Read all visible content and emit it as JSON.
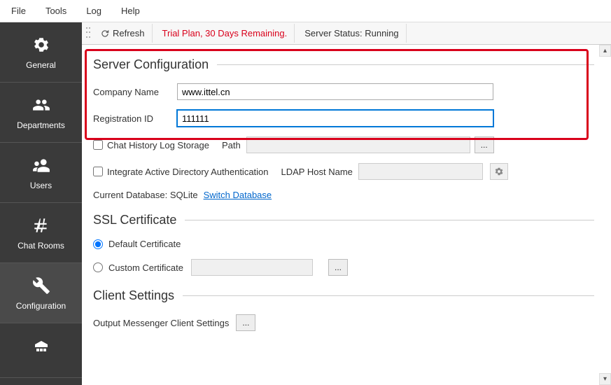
{
  "menu": {
    "file": "File",
    "tools": "Tools",
    "log": "Log",
    "help": "Help"
  },
  "topbar": {
    "refresh": "Refresh",
    "trial": "Trial Plan, 30 Days Remaining.",
    "status": "Server Status: Running"
  },
  "sidebar": {
    "general": "General",
    "departments": "Departments",
    "users": "Users",
    "chatrooms": "Chat Rooms",
    "configuration": "Configuration"
  },
  "serverConfig": {
    "heading": "Server Configuration",
    "companyLabel": "Company Name",
    "companyValue": "www.ittel.cn",
    "regLabel": "Registration ID",
    "regValue": "111111",
    "chatLog": "Chat History Log Storage",
    "path": "Path",
    "adAuth": "Integrate Active Directory Authentication",
    "ldap": "LDAP Host Name",
    "currentDb": "Current Database: SQLite",
    "switchDb": "Switch Database"
  },
  "ssl": {
    "heading": "SSL Certificate",
    "default": "Default Certificate",
    "custom": "Custom Certificate"
  },
  "client": {
    "heading": "Client Settings",
    "outputSettings": "Output Messenger Client Settings"
  }
}
